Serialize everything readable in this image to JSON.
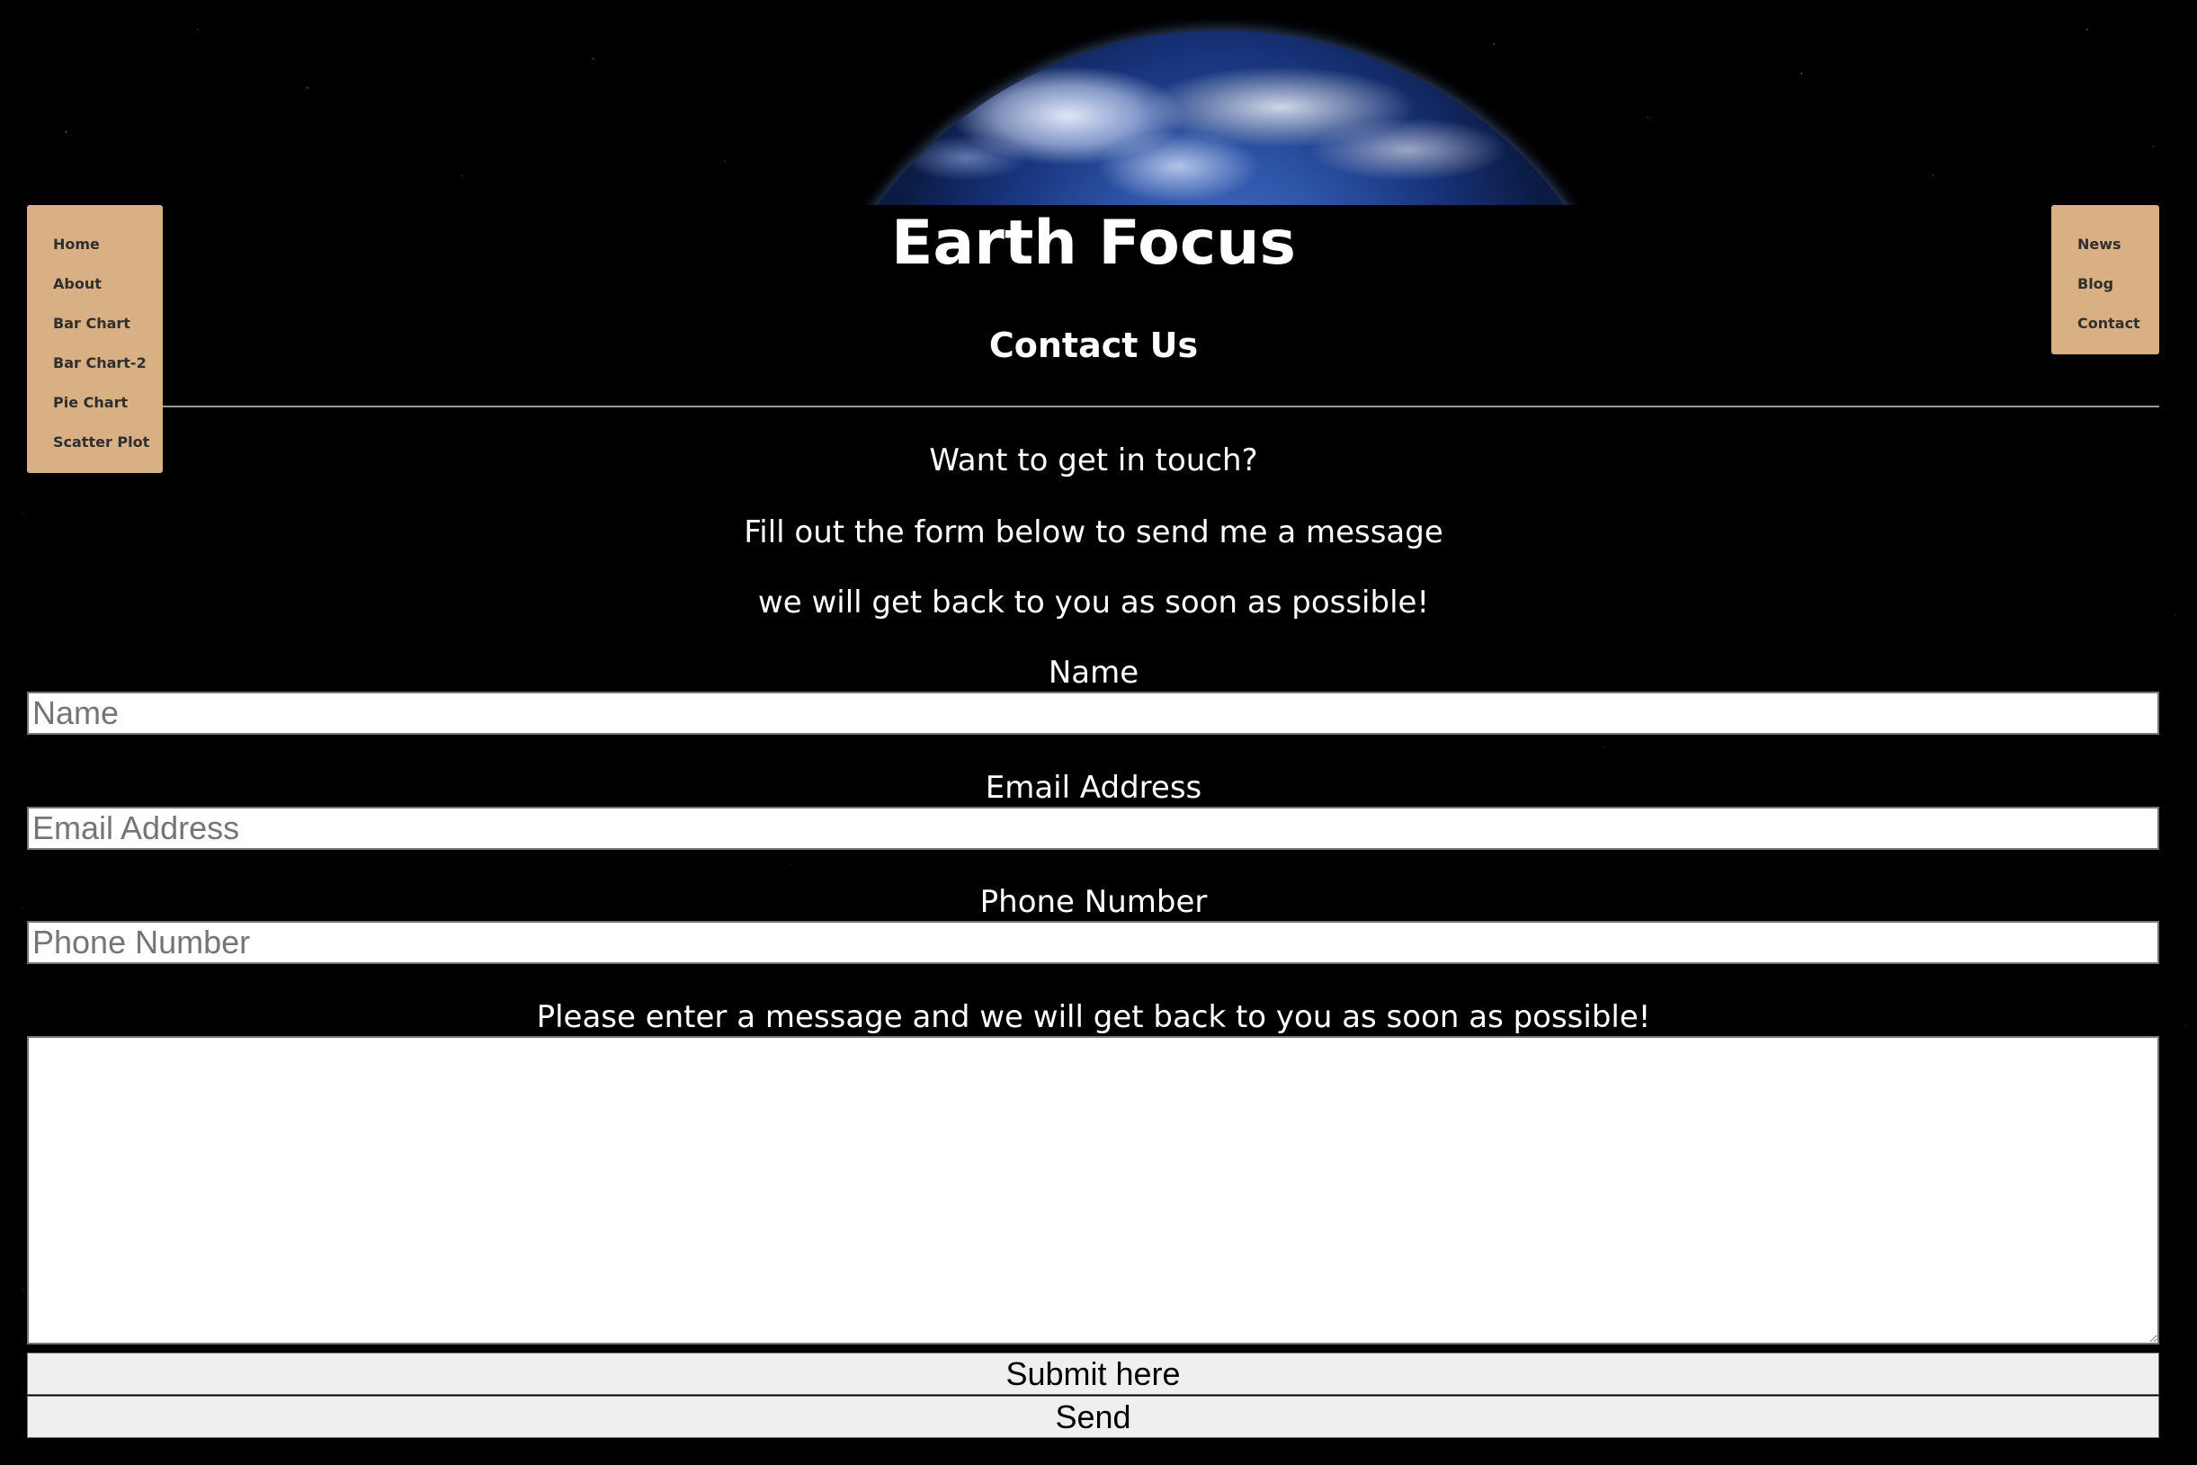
{
  "site": {
    "title": "Earth Focus",
    "heading": "Contact Us"
  },
  "nav_left": {
    "items": [
      {
        "label": "Home"
      },
      {
        "label": "About"
      },
      {
        "label": "Bar Chart"
      },
      {
        "label": "Bar Chart-2"
      },
      {
        "label": "Pie Chart"
      },
      {
        "label": "Scatter Plot"
      }
    ]
  },
  "nav_right": {
    "items": [
      {
        "label": "News"
      },
      {
        "label": "Blog"
      },
      {
        "label": "Contact"
      }
    ]
  },
  "intro": {
    "line1": "Want to get in touch?",
    "line2": "Fill out the form below to send me a message",
    "line3": "we will get back to you as soon as possible!"
  },
  "form": {
    "name": {
      "label": "Name",
      "placeholder": "Name",
      "value": ""
    },
    "email": {
      "label": "Email Address",
      "placeholder": "Email Address",
      "value": ""
    },
    "phone": {
      "label": "Phone Number",
      "placeholder": "Phone Number",
      "value": ""
    },
    "message": {
      "label": "Please enter a message and we will get back to you as soon as possible!",
      "value": ""
    },
    "submit_label": "Submit here",
    "send_label": "Send"
  },
  "colors": {
    "background": "#000000",
    "nav_background": "#d8b084",
    "nav_text": "#2f2f2f",
    "text": "#ffffff",
    "button_background": "#efefef"
  }
}
